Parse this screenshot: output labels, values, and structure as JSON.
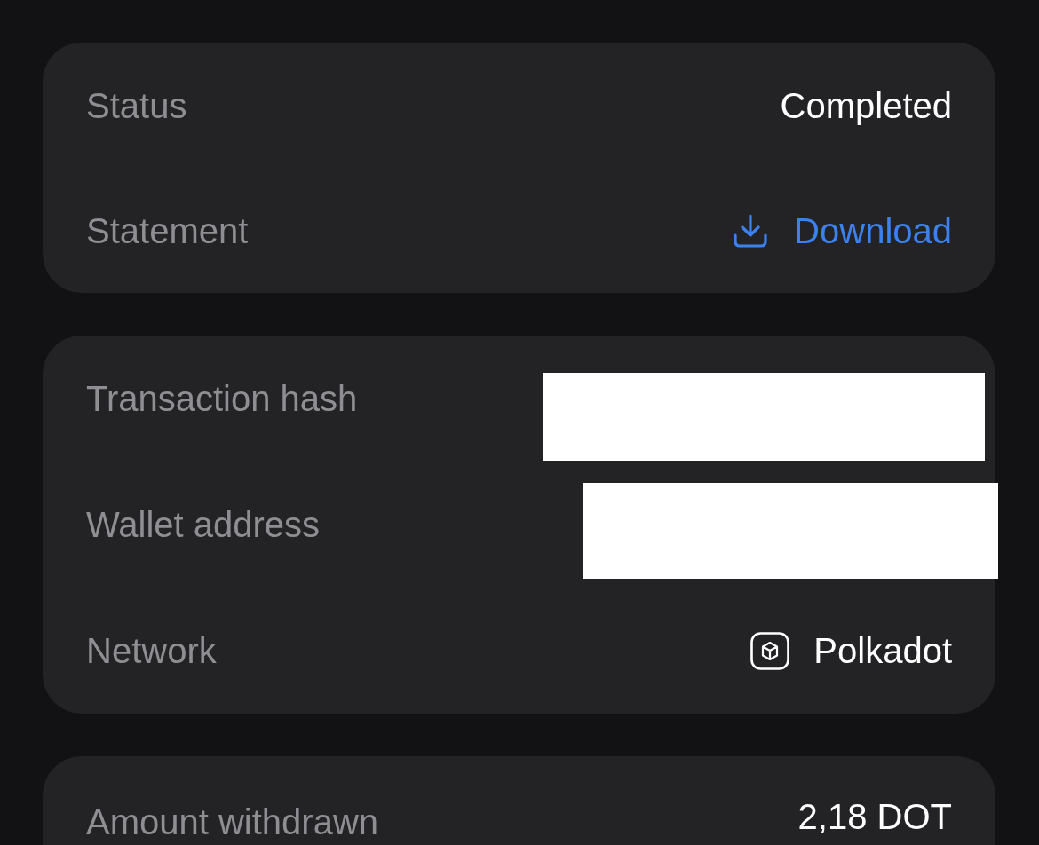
{
  "sections": [
    {
      "rows": [
        {
          "label": "Status",
          "kind": "text",
          "value": "Completed"
        },
        {
          "label": "Statement",
          "kind": "link",
          "value": "Download"
        }
      ]
    },
    {
      "rows": [
        {
          "label": "Transaction hash",
          "kind": "redacted"
        },
        {
          "label": "Wallet address",
          "kind": "redacted"
        },
        {
          "label": "Network",
          "kind": "network",
          "value": "Polkadot"
        }
      ]
    },
    {
      "rows": [
        {
          "label": "Amount withdrawn",
          "kind": "text",
          "value": "2,18 DOT"
        }
      ]
    }
  ]
}
